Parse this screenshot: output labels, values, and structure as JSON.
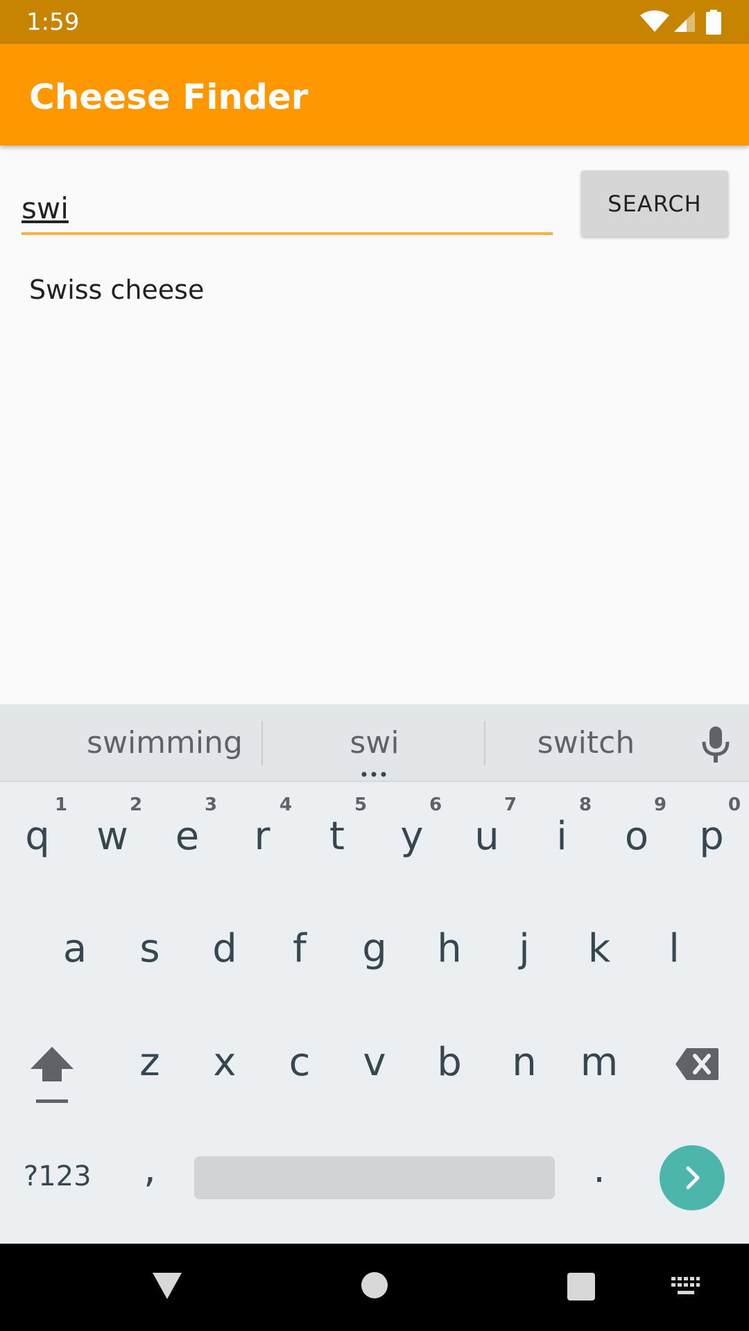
{
  "status_bar": {
    "time": "1:59"
  },
  "app_bar": {
    "title": "Cheese Finder"
  },
  "search": {
    "value": "swi",
    "button_label": "SEARCH"
  },
  "results": [
    {
      "label": "Swiss cheese"
    }
  ],
  "keyboard": {
    "suggestions": [
      "swimming",
      "swi",
      "switch"
    ],
    "row1": [
      "q",
      "w",
      "e",
      "r",
      "t",
      "y",
      "u",
      "i",
      "o",
      "p"
    ],
    "row1_hints": [
      "1",
      "2",
      "3",
      "4",
      "5",
      "6",
      "7",
      "8",
      "9",
      "0"
    ],
    "row2": [
      "a",
      "s",
      "d",
      "f",
      "g",
      "h",
      "j",
      "k",
      "l"
    ],
    "row3": [
      "z",
      "x",
      "c",
      "v",
      "b",
      "n",
      "m"
    ],
    "symbols_label": "?123",
    "comma": ",",
    "period": "."
  },
  "colors": {
    "status_bar": "#c68400",
    "app_bar": "#ff9800",
    "input_underline": "#fbb13c",
    "enter_key": "#4db6ac"
  }
}
